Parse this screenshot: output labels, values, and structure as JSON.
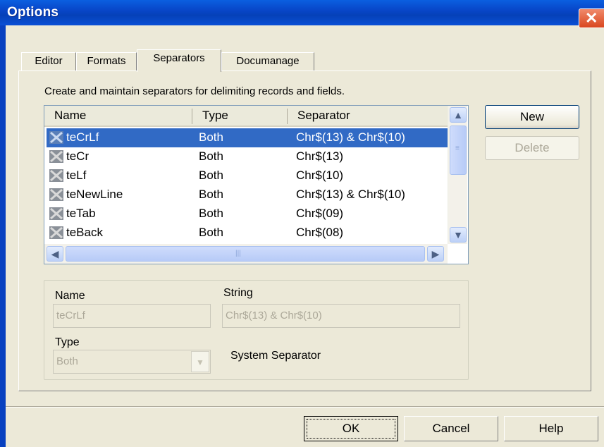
{
  "window": {
    "title": "Options",
    "close_icon": "close-icon"
  },
  "tabs": [
    {
      "label": "Editor"
    },
    {
      "label": "Formats"
    },
    {
      "label": "Separators"
    },
    {
      "label": "Documanage"
    }
  ],
  "description": "Create and maintain separators for delimiting records and fields.",
  "list": {
    "columns": [
      "Name",
      "Type",
      "Separator"
    ],
    "rows": [
      {
        "name": "teCrLf",
        "type": "Both",
        "separator": "Chr$(13) & Chr$(10)",
        "selected": true
      },
      {
        "name": "teCr",
        "type": "Both",
        "separator": "Chr$(13)",
        "selected": false
      },
      {
        "name": "teLf",
        "type": "Both",
        "separator": "Chr$(10)",
        "selected": false
      },
      {
        "name": "teNewLine",
        "type": "Both",
        "separator": "Chr$(13) & Chr$(10)",
        "selected": false
      },
      {
        "name": "teTab",
        "type": "Both",
        "separator": "Chr$(09)",
        "selected": false
      },
      {
        "name": "teBack",
        "type": "Both",
        "separator": "Chr$(08)",
        "selected": false
      }
    ],
    "row_icon": "separator-icon"
  },
  "side_buttons": {
    "new_label": "New",
    "delete_label": "Delete"
  },
  "details": {
    "name_label": "Name",
    "name_value": "teCrLf",
    "string_label": "String",
    "string_value": "Chr$(13) & Chr$(10)",
    "type_label": "Type",
    "type_value": "Both",
    "system_text": "System Separator"
  },
  "footer": {
    "ok_label": "OK",
    "cancel_label": "Cancel",
    "help_label": "Help"
  },
  "colors": {
    "title_bar": "#0846c8",
    "selection": "#316ac5",
    "dialog_bg": "#ece9d8"
  }
}
